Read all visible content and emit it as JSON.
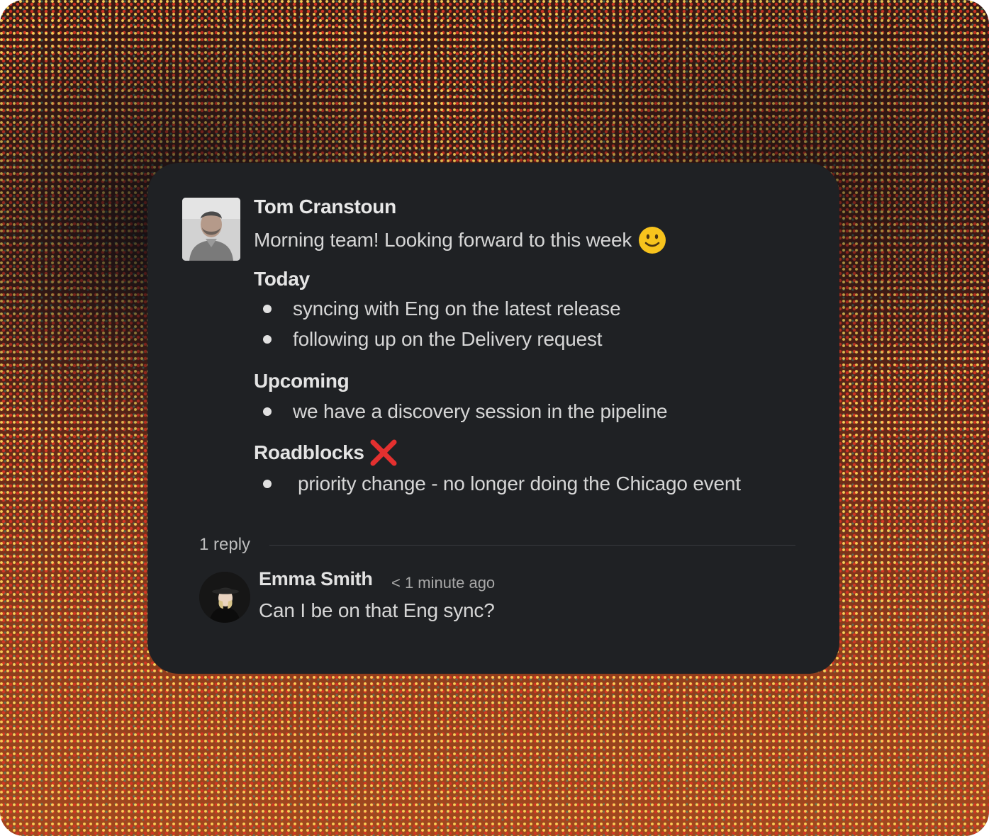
{
  "message": {
    "author": "Tom Cranstoun",
    "greeting": "Morning team! Looking forward to this week",
    "greeting_emoji": "slightly-smiling-face-icon",
    "sections": [
      {
        "heading": "Today",
        "items": [
          "syncing with Eng on the latest release",
          "following up on the Delivery request"
        ]
      },
      {
        "heading": "Upcoming",
        "items": [
          "we have a discovery session in the pipeline"
        ]
      },
      {
        "heading": "Roadblocks",
        "heading_emoji": "red-cross-mark-icon",
        "items": [
          "priority change - no longer doing the Chicago event"
        ]
      }
    ]
  },
  "thread": {
    "reply_count_label": "1 reply",
    "replies": [
      {
        "author": "Emma Smith",
        "time": "< 1 minute ago",
        "text": "Can I be on that Eng sync?"
      }
    ]
  },
  "colors": {
    "card_background": "#1f2124",
    "text_primary": "#e8e8e8",
    "text_secondary": "#d6d6d6",
    "cross_red": "#e3302f",
    "smile_yellow": "#f7c31d"
  }
}
